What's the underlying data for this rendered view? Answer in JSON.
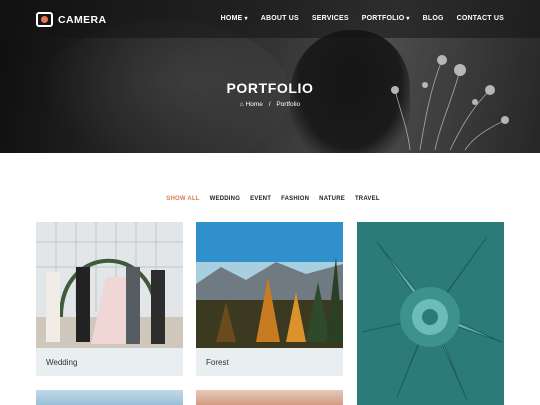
{
  "brand": {
    "name": "CAMERA",
    "accent": "#e07b4f"
  },
  "nav": [
    {
      "label": "HOME",
      "has_dropdown": true
    },
    {
      "label": "ABOUT US",
      "has_dropdown": false
    },
    {
      "label": "SERVICES",
      "has_dropdown": false
    },
    {
      "label": "PORTFOLIO",
      "has_dropdown": true
    },
    {
      "label": "BLOG",
      "has_dropdown": false
    },
    {
      "label": "CONTACT US",
      "has_dropdown": false
    }
  ],
  "hero": {
    "title": "PORTFOLIO",
    "breadcrumb": {
      "home": "Home",
      "separator": "/",
      "current": "Portfolio"
    }
  },
  "filters": [
    {
      "label": "SHOW ALL",
      "active": true
    },
    {
      "label": "WEDDING",
      "active": false
    },
    {
      "label": "EVENT",
      "active": false
    },
    {
      "label": "FASHION",
      "active": false
    },
    {
      "label": "NATURE",
      "active": false
    },
    {
      "label": "TRAVEL",
      "active": false
    }
  ],
  "portfolio": [
    {
      "caption": "Wedding",
      "image": "wedding-ceremony-photo"
    },
    {
      "caption": "Forest",
      "image": "autumn-forest-mountains-photo"
    },
    {
      "caption": "",
      "image": "teal-succulent-closeup-photo"
    }
  ],
  "icons": {
    "logo": "camera-lock-icon",
    "home": "home-icon",
    "caret": "chevron-down-icon"
  }
}
